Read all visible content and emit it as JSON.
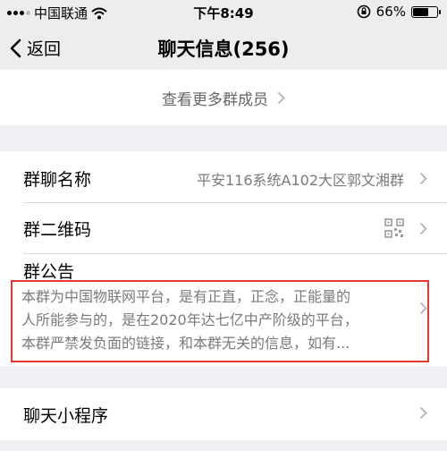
{
  "status_bar": {
    "carrier": "中国联通",
    "time": "下午8:49",
    "battery": "66%",
    "battery_level": 0.66
  },
  "nav": {
    "back_label": "返回",
    "title": "聊天信息(256)"
  },
  "members": {
    "more_label": "查看更多群成员"
  },
  "group_settings": {
    "name_label": "群聊名称",
    "name_value": "平安116系统A102大区郭文湘群",
    "qr_label": "群二维码",
    "notice_label": "群公告",
    "notice_lines": [
      "本群为中国物联网平台，是有正直，正念，正能量的",
      "人所能参与的，是在2020年达七亿中产阶级的平台，",
      "本群严禁发负面的链接，和本群无关的信息，如有..."
    ]
  },
  "mini_program": {
    "label": "聊天小程序"
  }
}
